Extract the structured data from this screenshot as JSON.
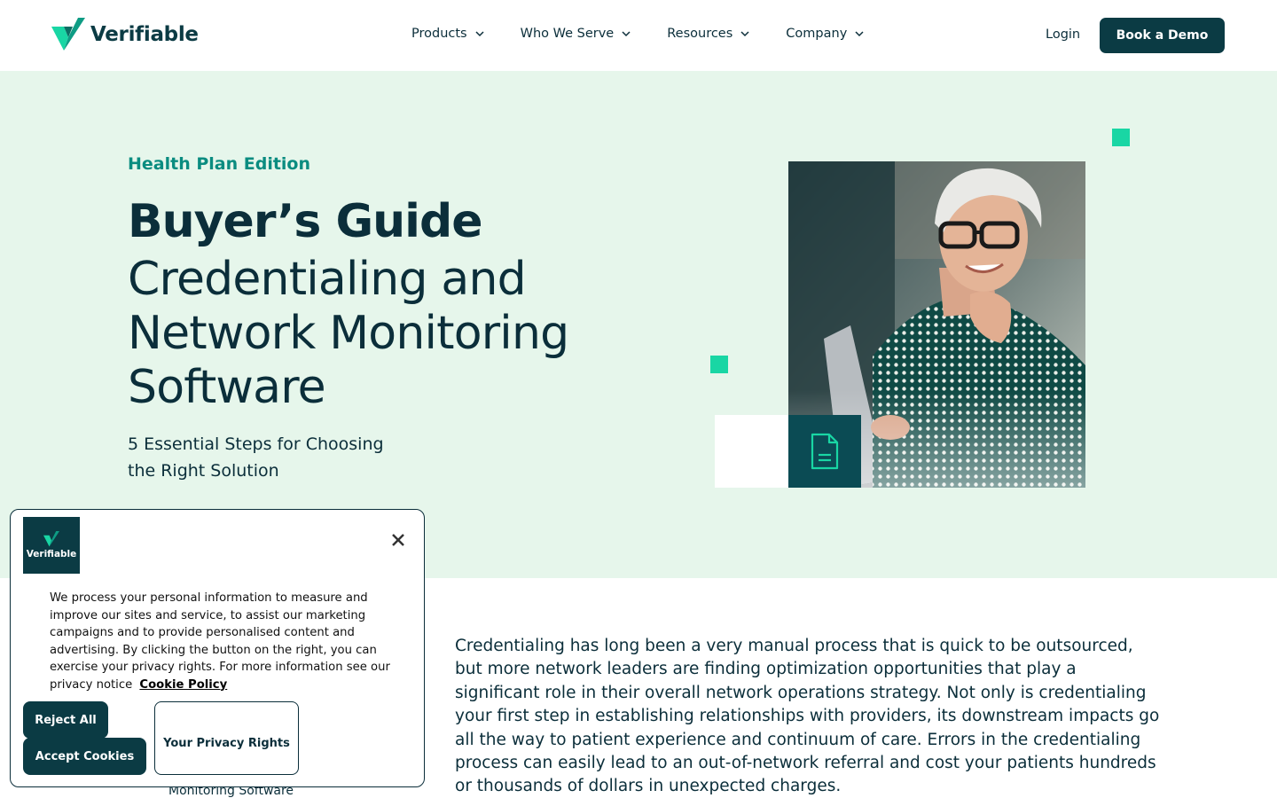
{
  "header": {
    "logo_text": "Verifiable",
    "nav": [
      {
        "label": "Products"
      },
      {
        "label": "Who We Serve"
      },
      {
        "label": "Resources"
      },
      {
        "label": "Company"
      }
    ],
    "login_label": "Login",
    "demo_label": "Book a Demo"
  },
  "hero": {
    "eyebrow": "Health Plan Edition",
    "title_bold": "Buyer’s Guide",
    "title_light": "Credentialing and Network Monitoring Software",
    "subtitle": "5 Essential Steps for Choosing the Right Solution",
    "image_alt": "Smiling woman with glasses using a laptop",
    "doc_icon": "document-icon"
  },
  "body": {
    "paragraph": "Credentialing has long been a very manual process that is quick to be outsourced, but more network leaders are finding optimization opportunities that play a significant role in their overall network operations strategy. Not only is credentialing your first step in establishing relationships with providers, its downstream impacts go all the way to patient experience and continuum of care. Errors in the credentialing process can easily lead to an out-of-network referral and cost your patients hundreds or thousands of dollars in unexpected charges.",
    "toc_peek": "Monitoring Software"
  },
  "cookie": {
    "logo_text": "Verifiable",
    "text": "We process your personal information to measure and improve our sites and service, to assist our marketing campaigns and to provide personalised content and advertising. By clicking the button on the right, you can exercise your privacy rights. For more information see our privacy notice",
    "link_label": "Cookie Policy",
    "reject_label": "Reject All",
    "accept_label": "Accept Cookies",
    "rights_label": "Your Privacy Rights"
  },
  "colors": {
    "brand_dark": "#0b3b44",
    "accent": "#19d6a4",
    "hero_bg": "#e6f6eb",
    "eyebrow": "#0a8c80"
  }
}
